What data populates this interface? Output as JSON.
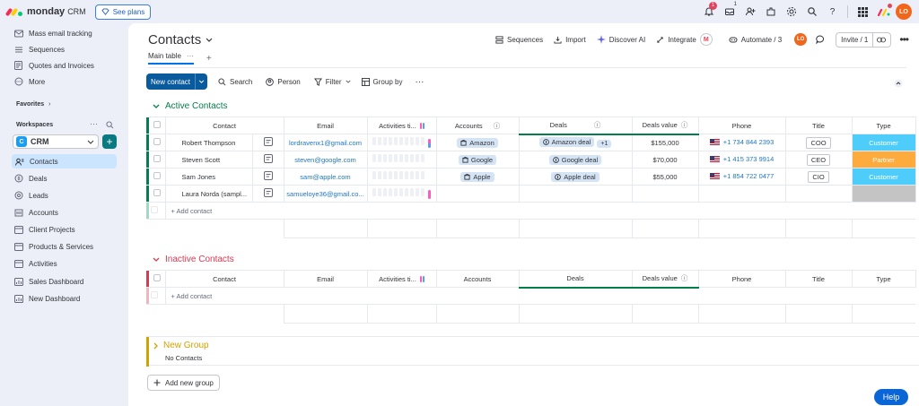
{
  "brand": {
    "name": "monday",
    "product": "CRM",
    "colors": [
      "#f62b54",
      "#ffcc00",
      "#00ca72"
    ]
  },
  "topbar": {
    "plans_label": "See plans",
    "notif_count": "1",
    "inbox_count": "1",
    "avatar_initials": "LO",
    "icons": [
      "bell-icon",
      "inbox-icon",
      "invite-members-icon",
      "apps-icon",
      "settings-icon",
      "search-icon",
      "help-icon",
      "app-switcher-icon"
    ]
  },
  "sidebar": {
    "top_items": [
      {
        "label": "Mass email tracking",
        "icon": "email-tracking-icon"
      },
      {
        "label": "Sequences",
        "icon": "sequences-icon"
      },
      {
        "label": "Quotes and Invoices",
        "icon": "invoice-icon"
      },
      {
        "label": "More",
        "icon": "more-icon"
      }
    ],
    "favorites_label": "Favorites",
    "workspaces_label": "Workspaces",
    "workspace_name": "CRM",
    "items": [
      {
        "label": "Contacts",
        "icon": "board-icon",
        "active": true
      },
      {
        "label": "Deals",
        "icon": "deals-icon"
      },
      {
        "label": "Leads",
        "icon": "leads-icon"
      },
      {
        "label": "Accounts",
        "icon": "accounts-icon"
      },
      {
        "label": "Client Projects",
        "icon": "board-icon"
      },
      {
        "label": "Products & Services",
        "icon": "board-icon"
      },
      {
        "label": "Activities",
        "icon": "board-icon"
      },
      {
        "label": "Sales Dashboard",
        "icon": "dashboard-icon"
      },
      {
        "label": "New Dashboard",
        "icon": "dashboard-icon"
      }
    ]
  },
  "board": {
    "title": "Contacts",
    "actions": {
      "sequences": "Sequences",
      "import": "Import",
      "discover_ai": "Discover AI",
      "integrate": "Integrate",
      "automate": "Automate / 3",
      "avatar_initials": "LO",
      "invite": "Invite / 1"
    },
    "tab_main": "Main table",
    "toolbar": {
      "new_contact": "New contact",
      "search": "Search",
      "person": "Person",
      "filter": "Filter",
      "group_by": "Group by"
    },
    "columns": [
      "Contact",
      "Email",
      "Activities ti...",
      "Accounts",
      "Deals",
      "Deals value",
      "Phone",
      "Title",
      "Type"
    ],
    "add_contact_label": "+ Add contact",
    "groups": [
      {
        "title": "Active Contacts",
        "color": "#037f4c",
        "rows": [
          {
            "name": "Robert Thompson",
            "email": "lordravenx1@gmail.com",
            "account": "Amazon",
            "deal": "Amazon deal",
            "deal_extra": "+1",
            "deal_value": "$155,000",
            "phone": "+1 734 844 2393",
            "title": "COO",
            "type": "Customer",
            "type_color": "#4eccfa",
            "activity_color": "#579bfc"
          },
          {
            "name": "Steven Scott",
            "email": "steven@google.com",
            "account": "Google",
            "deal": "Google deal",
            "deal_extra": "",
            "deal_value": "$70,000",
            "phone": "+1 415 373 9914",
            "title": "CEO",
            "type": "Partner",
            "type_color": "#fdab3d",
            "activity_color": ""
          },
          {
            "name": "Sam Jones",
            "email": "sam@apple.com",
            "account": "Apple",
            "deal": "Apple deal",
            "deal_extra": "",
            "deal_value": "$55,000",
            "phone": "+1 854 722 0477",
            "title": "CIO",
            "type": "Customer",
            "type_color": "#4eccfa",
            "activity_color": ""
          },
          {
            "name": "Laura Norda (sampl...",
            "email": "samueloye36@gmail.co...",
            "account": "",
            "deal": "",
            "deal_extra": "",
            "deal_value": "",
            "phone": "",
            "title": "",
            "type": "",
            "type_color": "#c4c4c4",
            "activity_color": "#ff5ac4"
          }
        ]
      },
      {
        "title": "Inactive Contacts",
        "color": "#d83a52",
        "rows": []
      },
      {
        "title": "New Group",
        "color": "#d5a100",
        "empty_label": "No Contacts"
      }
    ],
    "add_group_label": "Add new group"
  },
  "help_label": "Help"
}
